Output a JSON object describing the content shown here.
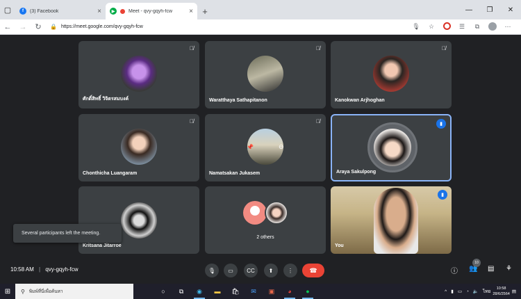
{
  "browser": {
    "tabs": [
      {
        "label": "(3) Facebook",
        "icon": "facebook-icon"
      },
      {
        "label": "Meet - qvy-gqyh-fcw",
        "icon": "meet-icon"
      }
    ],
    "url": "https://meet.google.com/qvy-gqyh-fcw"
  },
  "participants": [
    {
      "name": "ศักดิ์สิทธิ์ วิจิตรสมบงค์",
      "muted": true
    },
    {
      "name": "Waratthaya Sathapitanon",
      "muted": true
    },
    {
      "name": "Kanokwan Arjhoghan",
      "muted": true
    },
    {
      "name": "Chonthicha Luangaram",
      "muted": true
    },
    {
      "name": "Namatsakan Jukasem",
      "muted": true
    },
    {
      "name": "Araya Sakulpong",
      "speaking": true
    },
    {
      "name": "Kritsana Jitarroe",
      "muted": false
    },
    {
      "name": "2 others"
    },
    {
      "name": "You",
      "speaking": true
    }
  ],
  "snackbar": "Several participants left the meeting.",
  "meeting": {
    "time": "10:58 AM",
    "separator": "|",
    "code": "qvy-gqyh-fcw",
    "participant_count": "10"
  },
  "taskbar": {
    "search_placeholder": "พิมพ์ที่นี่เพื่อค้นหา",
    "lang": "ไทย",
    "time": "10:58",
    "date": "28/6/2564"
  },
  "colors": {
    "meet_bg": "#202124",
    "tile_bg": "#3c4043",
    "accent": "#1a73e8",
    "hangup": "#ea4335"
  }
}
